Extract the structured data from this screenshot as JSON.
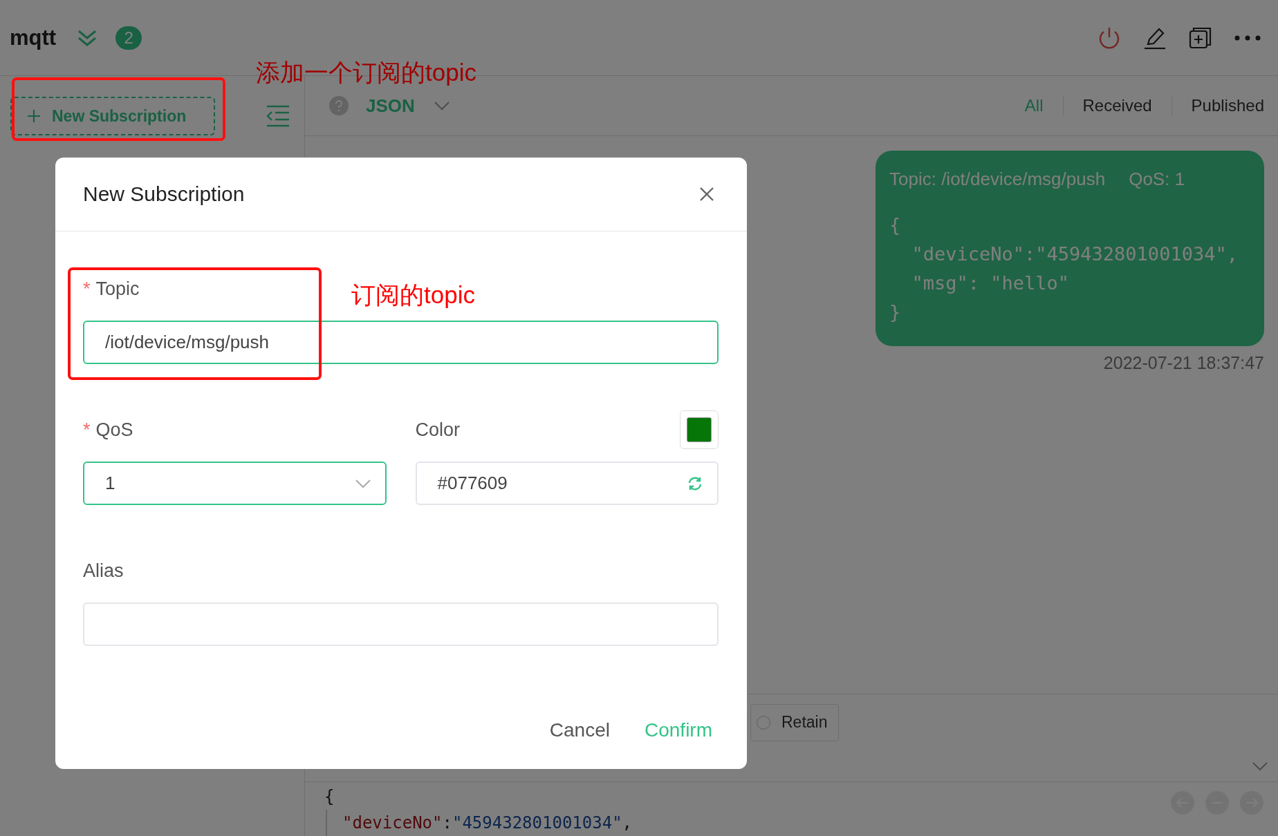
{
  "header": {
    "title": "mqtt",
    "count": "2"
  },
  "sidebar": {
    "new_subscription": "New Subscription"
  },
  "toolbar": {
    "format": "JSON",
    "tabs": [
      {
        "label": "All",
        "selected": true
      },
      {
        "label": "Received",
        "selected": false
      },
      {
        "label": "Published",
        "selected": false
      }
    ]
  },
  "message": {
    "topic": "Topic: /iot/device/msg/push",
    "qos": "QoS: 1",
    "payload": [
      "{",
      "  \"deviceNo\":\"459432801001034\",",
      "  \"msg\": \"hello\"",
      "}"
    ],
    "time": "2022-07-21 18:37:47"
  },
  "composer": {
    "retain": {
      "label": "Retain",
      "checked": false
    },
    "editor": [
      [
        {
          "kind": "punct",
          "text": "{"
        }
      ],
      [
        {
          "kind": "key",
          "text": "\"deviceNo\""
        },
        {
          "kind": "punct",
          "text": ":"
        },
        {
          "kind": "string",
          "text": "\"459432801001034\""
        },
        {
          "kind": "punct",
          "text": ","
        }
      ]
    ]
  },
  "dialog": {
    "title": "New Subscription",
    "topic": {
      "mark": "*",
      "label": "Topic",
      "value": "/iot/device/msg/push",
      "active": true
    },
    "qos": {
      "mark": "*",
      "label": "QoS",
      "value": "1",
      "active": true
    },
    "color": {
      "label": "Color",
      "value": "#077609",
      "color": "#077609"
    },
    "alias": {
      "label": "Alias"
    },
    "buttons": {
      "cancel": "Cancel",
      "confirm": "Confirm"
    }
  },
  "annotations": [
    {
      "text": "添加一个订阅的topic"
    },
    {
      "text": "订阅的topic"
    }
  ]
}
